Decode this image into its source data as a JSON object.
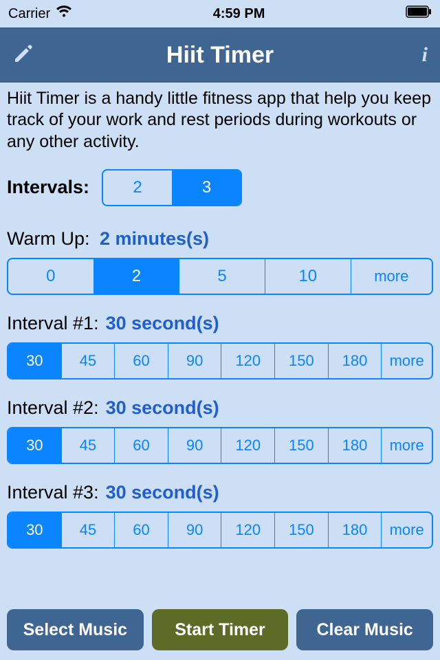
{
  "statusBar": {
    "carrier": "Carrier",
    "time": "4:59 PM"
  },
  "nav": {
    "title": "Hiit Timer"
  },
  "description": "Hiit Timer is a handy little fitness app that help you keep track of your work and rest periods during workouts or any other activity.",
  "intervals": {
    "label": "Intervals:",
    "options": [
      "2",
      "3"
    ],
    "selectedIndex": 1
  },
  "warmup": {
    "label": "Warm Up:",
    "value": "2 minutes(s)",
    "options": [
      "0",
      "2",
      "5",
      "10",
      "more"
    ],
    "selectedIndex": 1
  },
  "intervalRows": [
    {
      "label": "Interval #1:",
      "value": "30 second(s)",
      "options": [
        "30",
        "45",
        "60",
        "90",
        "120",
        "150",
        "180",
        "more"
      ],
      "selectedIndex": 0
    },
    {
      "label": "Interval #2:",
      "value": "30 second(s)",
      "options": [
        "30",
        "45",
        "60",
        "90",
        "120",
        "150",
        "180",
        "more"
      ],
      "selectedIndex": 0
    },
    {
      "label": "Interval #3:",
      "value": "30 second(s)",
      "options": [
        "30",
        "45",
        "60",
        "90",
        "120",
        "150",
        "180",
        "more"
      ],
      "selectedIndex": 0
    }
  ],
  "buttons": {
    "selectMusic": "Select Music",
    "startTimer": "Start Timer",
    "clearMusic": "Clear Music"
  }
}
